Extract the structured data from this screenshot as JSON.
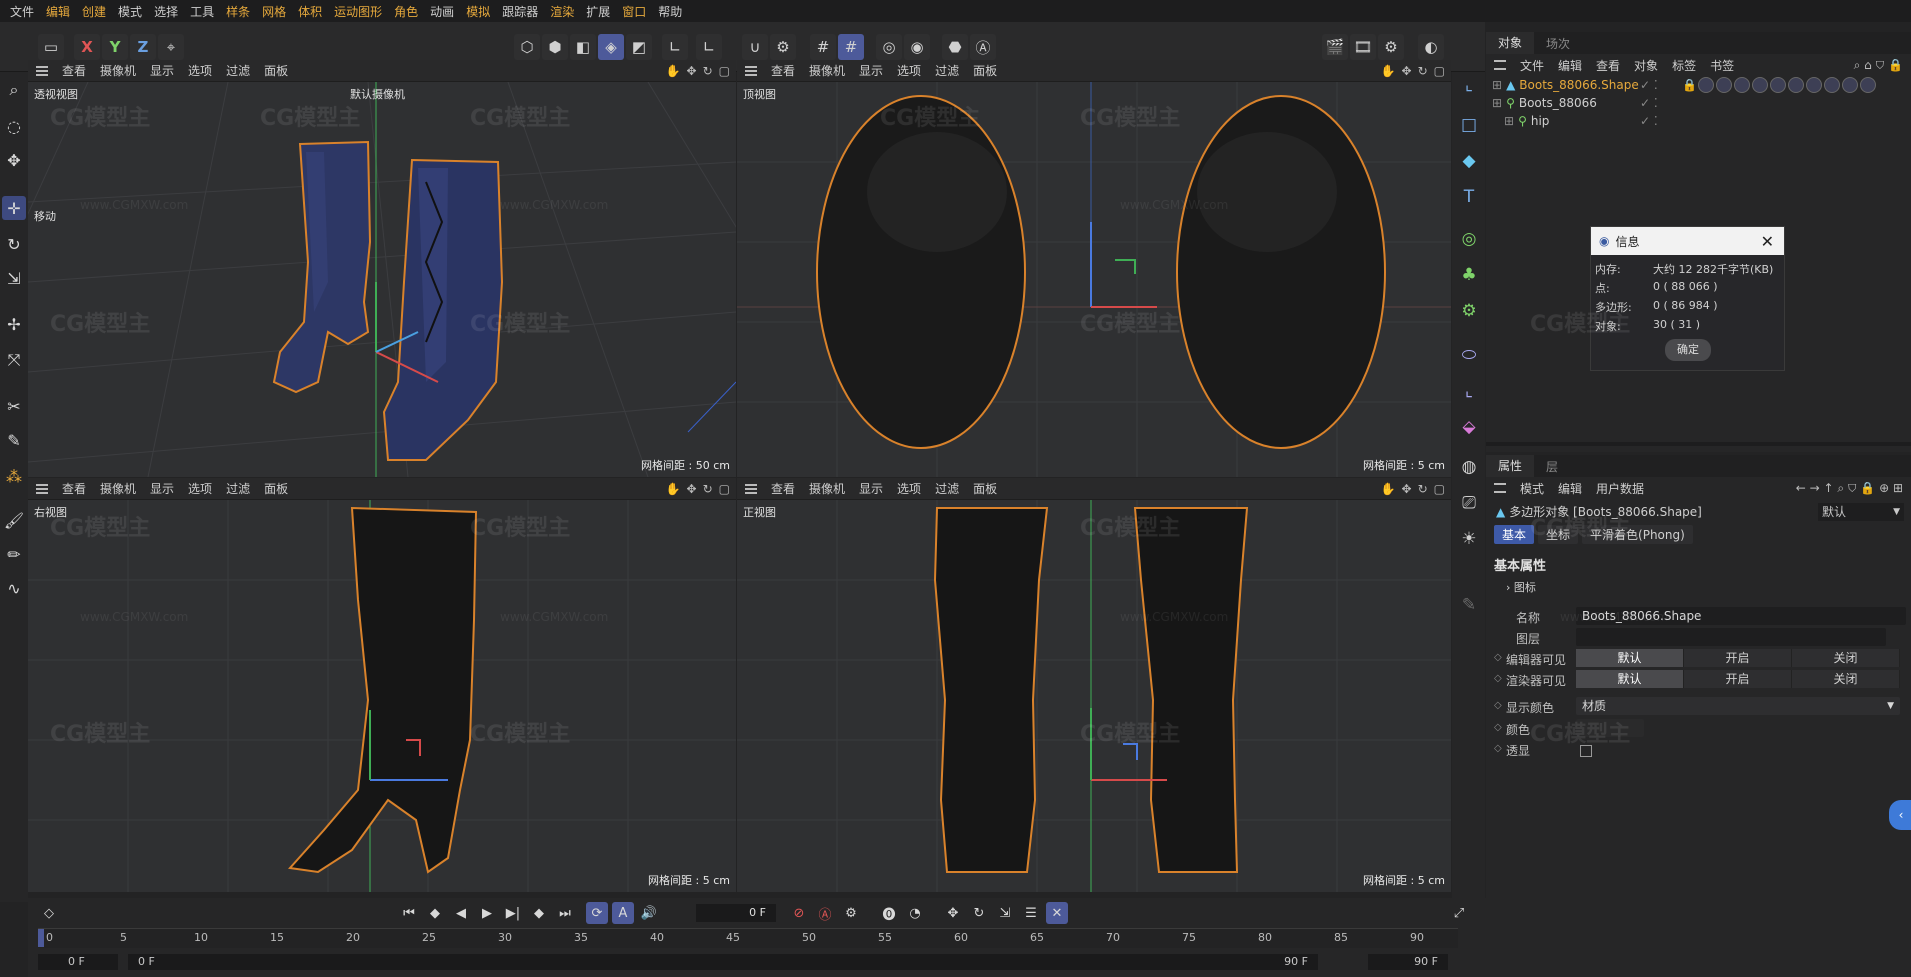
{
  "menu": [
    "文件",
    "编辑",
    "创建",
    "模式",
    "选择",
    "工具",
    "样条",
    "网格",
    "体积",
    "运动图形",
    "角色",
    "动画",
    "模拟",
    "跟踪器",
    "渲染",
    "扩展",
    "窗口",
    "帮助"
  ],
  "viewport_menu": [
    "查看",
    "摄像机",
    "显示",
    "选项",
    "过滤",
    "面板"
  ],
  "viewports": {
    "perspective": {
      "title": "透视视图",
      "camera": "默认摄像机",
      "grid": "网格间距 : 50 cm",
      "mode": "移动"
    },
    "top": {
      "title": "顶视图",
      "grid": "网格间距 : 5 cm"
    },
    "right": {
      "title": "右视图",
      "grid": "网格间距 : 5 cm"
    },
    "front": {
      "title": "正视图",
      "grid": "网格间距 : 5 cm"
    }
  },
  "axes": {
    "x": "X",
    "y": "Y",
    "z": "Z"
  },
  "object_panel": {
    "tabs": [
      "对象",
      "场次"
    ],
    "submenu": [
      "文件",
      "编辑",
      "查看",
      "对象",
      "标签",
      "书签"
    ],
    "objects": [
      {
        "name": "Boots_88066.Shape",
        "selected": true
      },
      {
        "name": "Boots_88066",
        "selected": false
      },
      {
        "name": "hip",
        "selected": false
      }
    ]
  },
  "info_dialog": {
    "title": "信息",
    "rows": [
      {
        "label": "内存:",
        "value": "大约 12 282千字节(KB)"
      },
      {
        "label": "点:",
        "value": "0 ( 88 066 )"
      },
      {
        "label": "多边形:",
        "value": "0 ( 86 984 )"
      },
      {
        "label": "对象:",
        "value": "30 ( 31 )"
      }
    ],
    "ok": "确定"
  },
  "attr_panel": {
    "tabs": [
      "属性",
      "层"
    ],
    "submenu": [
      "模式",
      "编辑",
      "用户数据"
    ],
    "object_title": "多边形对象 [Boots_88066.Shape]",
    "preset": "默认",
    "subtabs": [
      "基本",
      "坐标",
      "平滑着色(Phong)"
    ],
    "section": "基本属性",
    "icon_group": "图标",
    "name_label": "名称",
    "name_value": "Boots_88066.Shape",
    "layer_label": "图层",
    "editor_visible_label": "编辑器可见",
    "render_visible_label": "渲染器可见",
    "vis_options": [
      "默认",
      "开启",
      "关闭"
    ],
    "display_color_label": "显示颜色",
    "display_color_value": "材质",
    "color_label": "颜色",
    "xray_label": "透显"
  },
  "timeline": {
    "current_frame": "0 F",
    "start": "0 F",
    "start2": "0 F",
    "end": "90 F",
    "end2": "90 F",
    "ticks": [
      "0",
      "5",
      "10",
      "15",
      "20",
      "25",
      "30",
      "35",
      "40",
      "45",
      "50",
      "55",
      "60",
      "65",
      "70",
      "75",
      "80",
      "85",
      "90"
    ]
  },
  "watermark": {
    "logo": "CG模型主",
    "url": "www.CGMXW.com"
  },
  "colors": {
    "accent": "#4d5a9a",
    "selection": "#e6a93c",
    "outline": "#d9822b",
    "boot": "#2c3563"
  }
}
